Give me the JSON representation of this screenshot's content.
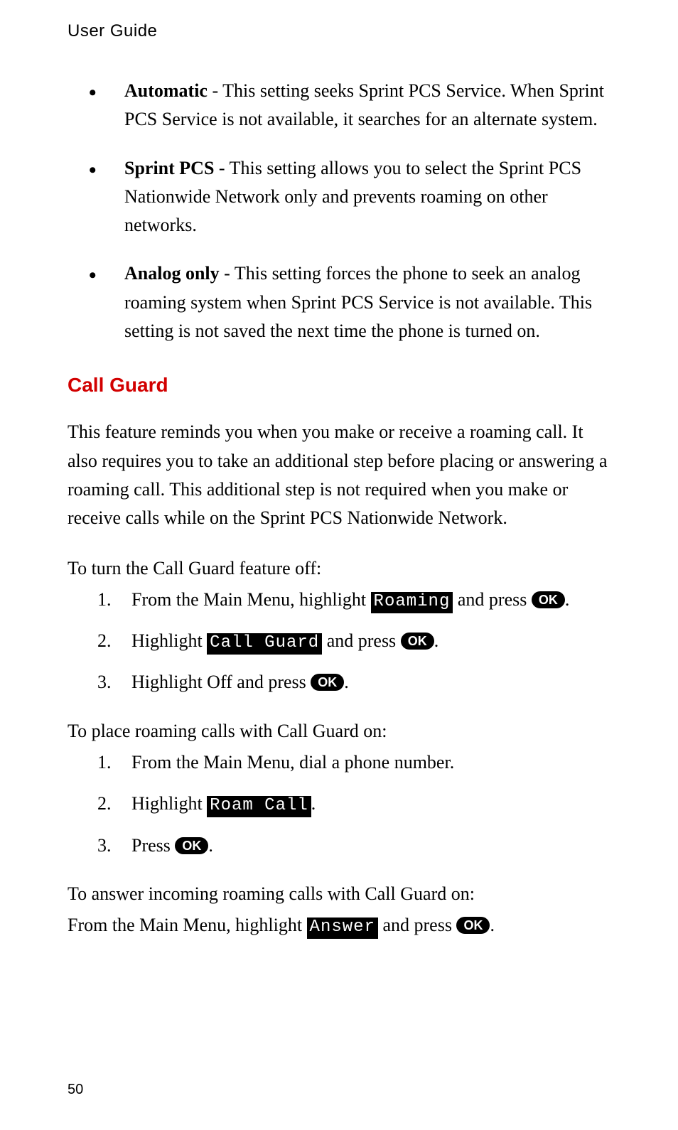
{
  "header": "User Guide",
  "bullets": [
    {
      "term": "Automatic",
      "desc": " - This setting seeks Sprint PCS Service. When Sprint PCS Service is not available, it searches for an alternate system."
    },
    {
      "term": "Sprint PCS",
      "desc": " - This setting allows you to select the Sprint PCS Nationwide Network only and prevents roaming on other networks."
    },
    {
      "term": "Analog only",
      "desc": " - This setting forces the phone to seek an analog roaming system when Sprint PCS Service is not available. This setting is not saved the next time the phone is turned on."
    }
  ],
  "section_heading": "Call Guard",
  "body_para": "This feature reminds you when you make or receive a roaming call. It also requires you to take an additional step before placing or answering a roaming call. This additional step is not required when you make or receive calls while on the Sprint PCS Nationwide Network.",
  "procedure1_intro": "To turn the Call Guard feature off:",
  "procedure1": {
    "step1_pre": "From the Main Menu, highlight ",
    "step1_menu": "Roaming",
    "step1_post": " and press ",
    "step1_btn": "OK",
    "step1_end": ".",
    "step2_pre": "Highlight ",
    "step2_menu": "Call Guard",
    "step2_post": " and press ",
    "step2_btn": "OK",
    "step2_end": ".",
    "step3_pre": "Highlight Off and press ",
    "step3_btn": "OK",
    "step3_end": "."
  },
  "procedure2_intro": "To place roaming calls with Call Guard on:",
  "procedure2": {
    "step1": "From the Main Menu, dial a phone number.",
    "step2_pre": "Highlight ",
    "step2_menu": "Roam Call",
    "step2_end": ".",
    "step3_pre": "Press ",
    "step3_btn": "OK",
    "step3_end": "."
  },
  "procedure3_intro": "To answer incoming roaming calls with Call Guard on:",
  "procedure3": {
    "line_pre": "From the Main Menu, highlight ",
    "line_menu": "Answer",
    "line_post": " and press ",
    "line_btn": "OK",
    "line_end": "."
  },
  "page_number": "50"
}
